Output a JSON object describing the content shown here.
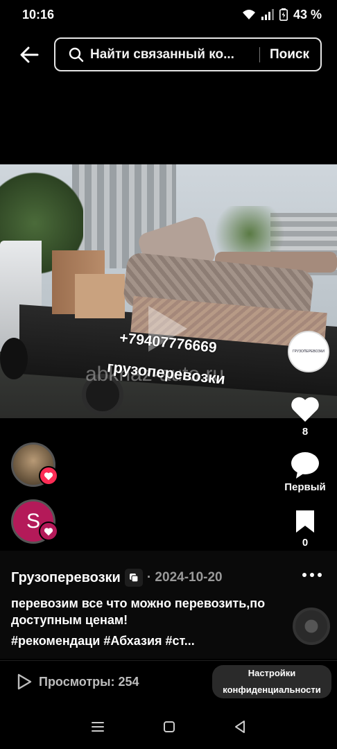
{
  "status": {
    "time": "10:16",
    "battery": "43 %"
  },
  "search": {
    "text": "Найти связанный ко...",
    "button": "Поиск"
  },
  "video": {
    "phone_overlay": "+79407776669",
    "text_overlay": "грузоперевозки",
    "watermark": "abkhaz-auto.ru",
    "logo_text": "ГРУЗОПЕРЕВОЗКИ"
  },
  "actions": {
    "likes": "8",
    "comment_label": "Первый",
    "saves": "0"
  },
  "avatar2_letter": "S",
  "post": {
    "author": "Грузоперевозки",
    "date": "· 2024-10-20",
    "description": "перевозим все что можно перевозить,по доступным ценам!",
    "tags": "#рекомендаци #Абхазия #ст..."
  },
  "footer": {
    "views": "Просмотры: 254",
    "privacy": "Настройки конфиденциальности"
  },
  "colors": {
    "accent": "#fe2c55",
    "avatar": "#b41a59"
  }
}
